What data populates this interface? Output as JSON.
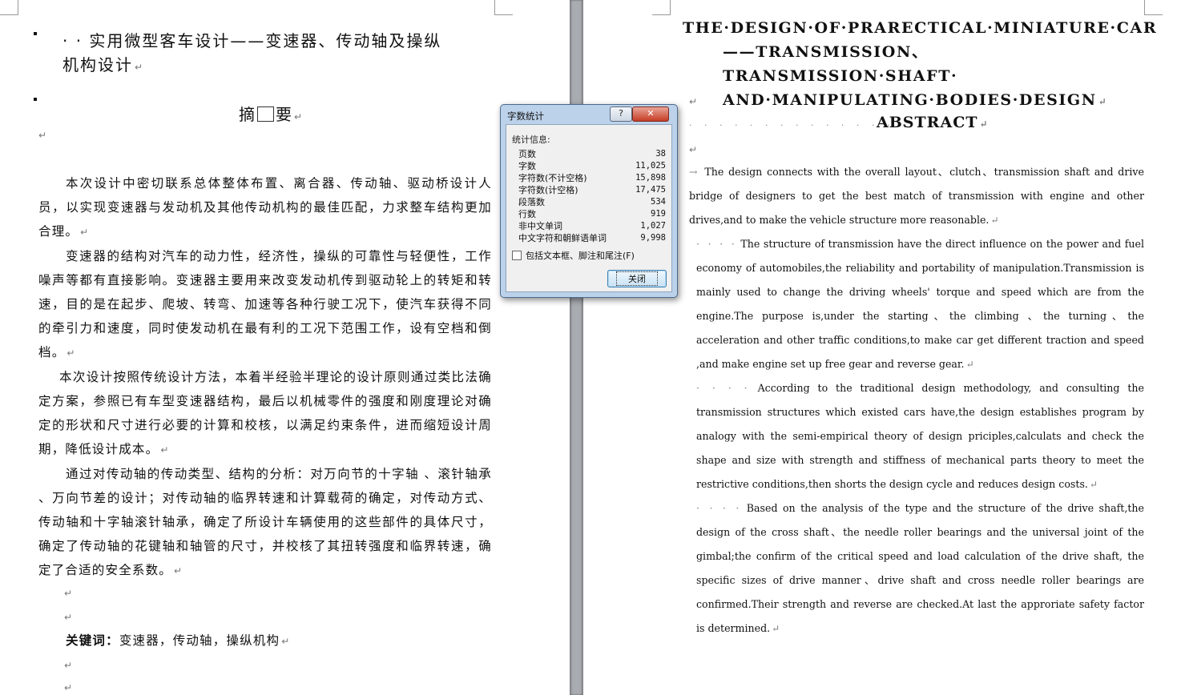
{
  "left_page": {
    "title": "· · 实用微型客车设计——变速器、传动轴及操纵机构设计",
    "title_line1": "· · 实用微型客车设计——变速器、传动轴及操纵",
    "title_line2": "机构设计",
    "abstract_title_a": "摘",
    "abstract_title_b": "要",
    "paragraphs": [
      "本次设计中密切联系总体整体布置、离合器、传动轴、驱动桥设计人员，以实现变速器与发动机及其他传动机构的最佳匹配，力求整车结构更加合理。",
      "变速器的结构对汽车的动力性，经济性，操纵的可靠性与轻便性，工作噪声等都有直接影响。变速器主要用来改变发动机传到驱动轮上的转矩和转速，目的是在起步、爬坡、转弯、加速等各种行驶工况下，使汽车获得不同的牵引力和速度，同时使发动机在最有利的工况下范围工作，设有空档和倒档。",
      "本次设计按照传统设计方法，本着半经验半理论的设计原则通过类比法确定方案，参照已有车型变速器结构，最后以机械零件的强度和刚度理论对确定的形状和尺寸进行必要的计算和校核，以满足约束条件，进而缩短设计周期，降低设计成本。",
      "通过对传动轴的传动类型、结构的分析：对万向节的十字轴 、滚针轴承 、万向节差的设计；对传动轴的临界转速和计算载荷的确定，对传动方式、传动轴和十字轴滚针轴承，确定了所设计车辆使用的这些部件的具体尺寸，确定了传动轴的花键轴和轴管的尺寸，并校核了其扭转强度和临界转速，确定了合适的安全系数。"
    ],
    "keywords_label": "关键词：",
    "keywords": "变速器，传动轴，操纵机构",
    "para_mark": "↵"
  },
  "right_page": {
    "title_line1": "THE·DESIGN·OF·PRARECTICAL·MINIATURE·CAR",
    "title_line2": "——TRANSMISSION、TRANSMISSION·SHAFT·",
    "title_line3": "AND·MANIPULATING·BODIES·DESIGN",
    "abstract_lead": "· · · · · · · · · · · · · · · · ·",
    "abstract_title": "ABSTRACT",
    "p1": "The design connects with the overall layout、clutch、transmission shaft and drive bridge of designers to get the best match of transmission with engine and other drives,and  to make the vehicle structure more reasonable.",
    "p2": "The structure of transmission have the direct influence on the power and fuel economy of automobiles,the reliability and portability of manipulation.Transmission is mainly used to change the driving wheels' torque and speed which are from the engine.The purpose is,under the starting、the climbing 、the turning、the acceleration and other traffic conditions,to make car get different traction and speed ,and make engine set up free gear and reverse gear.",
    "p3": "According to the traditional design methodology, and consulting the transmission structures which existed cars have,the design establishes program by analogy with the semi-empirical theory of design priciples,calculats and check the shape and size with strength and stiffness of mechanical parts theory to meet the restrictive conditions,then shorts the design cycle and reduces design costs.",
    "p4": "Based on the analysis of the type and the structure of the drive shaft,the design of the cross shaft、the needle roller bearings and the universal joint of the gimbal;the confirm of the critical speed and load calculation of the drive shaft, the specific sizes of drive manner、drive shaft and cross needle roller bearings are confirmed.Their strength and reverse are checked.At last the approriate safety factor is determined.",
    "indent_lead": "· · · ·",
    "first_lead": "→",
    "para_mark": "↵"
  },
  "dialog": {
    "title": "字数统计",
    "help_label": "?",
    "close_label": "✕",
    "section_label": "统计信息:",
    "stats": [
      {
        "label": "页数",
        "value": "38"
      },
      {
        "label": "字数",
        "value": "11,025"
      },
      {
        "label": "字符数(不计空格)",
        "value": "15,898"
      },
      {
        "label": "字符数(计空格)",
        "value": "17,475"
      },
      {
        "label": "段落数",
        "value": "534"
      },
      {
        "label": "行数",
        "value": "919"
      },
      {
        "label": "非中文单词",
        "value": "1,027"
      },
      {
        "label": "中文字符和朝鲜语单词",
        "value": "9,998"
      }
    ],
    "checkbox_label": "包括文本框、脚注和尾注(F)",
    "checkbox_checked": false,
    "button_label": "关闭"
  }
}
